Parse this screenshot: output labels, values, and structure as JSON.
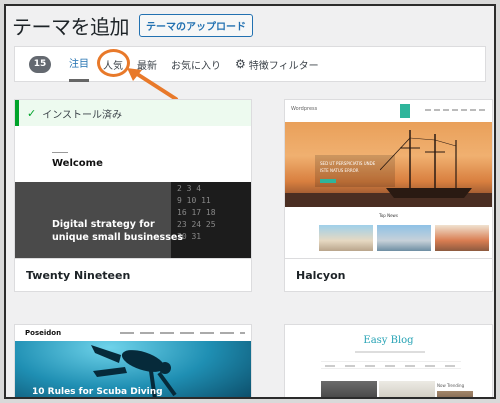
{
  "header": {
    "title": "テーマを追加",
    "upload_button": "テーマのアップロード"
  },
  "filter_bar": {
    "count": "15",
    "tabs": [
      {
        "label": "注目",
        "active": true
      },
      {
        "label": "人気",
        "active": false
      },
      {
        "label": "最新",
        "active": false
      },
      {
        "label": "お気に入り",
        "active": false
      }
    ],
    "feature_filter": "特徴フィルター"
  },
  "themes": [
    {
      "name": "Twenty Nineteen",
      "installed_label": "インストール済み",
      "preview": {
        "heading": "Welcome",
        "tagline_line1": "Digital strategy for",
        "tagline_line2": "unique small businesses"
      }
    },
    {
      "name": "Halcyon",
      "preview": {
        "site": "Wordpress",
        "hero_line1": "SED UT PERSPICIATIS UNDE",
        "hero_line2": "ISTE NATUS ERROR",
        "section": "Top News"
      }
    },
    {
      "name": "Poseidon",
      "preview": {
        "logo": "Poseidon",
        "headline": "10 Rules for Scuba Diving"
      }
    },
    {
      "name": "Easy Blog",
      "preview": {
        "title": "Easy Blog",
        "trending": "Now Trending"
      }
    }
  ],
  "colors": {
    "accent": "#2271b1",
    "installed": "#00a32a",
    "annotation": "#e8792a"
  }
}
